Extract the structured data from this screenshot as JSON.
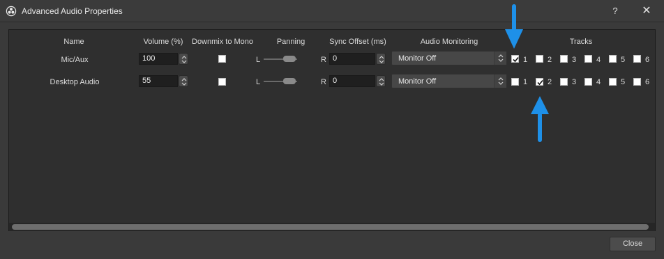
{
  "window": {
    "title": "Advanced Audio Properties",
    "help_glyph": "?",
    "close_glyph": "✕"
  },
  "columns": {
    "name": "Name",
    "volume": "Volume (%)",
    "downmix": "Downmix to Mono",
    "panning": "Panning",
    "sync": "Sync Offset (ms)",
    "monitoring": "Audio Monitoring",
    "tracks": "Tracks"
  },
  "pan_left": "L",
  "pan_right": "R",
  "rows": [
    {
      "name": "Mic/Aux",
      "volume": "100",
      "downmix": false,
      "sync": "0",
      "monitoring": "Monitor Off",
      "tracks": [
        {
          "n": "1",
          "checked": true
        },
        {
          "n": "2",
          "checked": false
        },
        {
          "n": "3",
          "checked": false
        },
        {
          "n": "4",
          "checked": false
        },
        {
          "n": "5",
          "checked": false
        },
        {
          "n": "6",
          "checked": false
        }
      ]
    },
    {
      "name": "Desktop Audio",
      "volume": "55",
      "downmix": false,
      "sync": "0",
      "monitoring": "Monitor Off",
      "tracks": [
        {
          "n": "1",
          "checked": false
        },
        {
          "n": "2",
          "checked": true
        },
        {
          "n": "3",
          "checked": false
        },
        {
          "n": "4",
          "checked": false
        },
        {
          "n": "5",
          "checked": false
        },
        {
          "n": "6",
          "checked": false
        }
      ]
    }
  ],
  "buttons": {
    "close": "Close"
  },
  "annotations": {
    "arrow_color": "#1e90e8"
  }
}
